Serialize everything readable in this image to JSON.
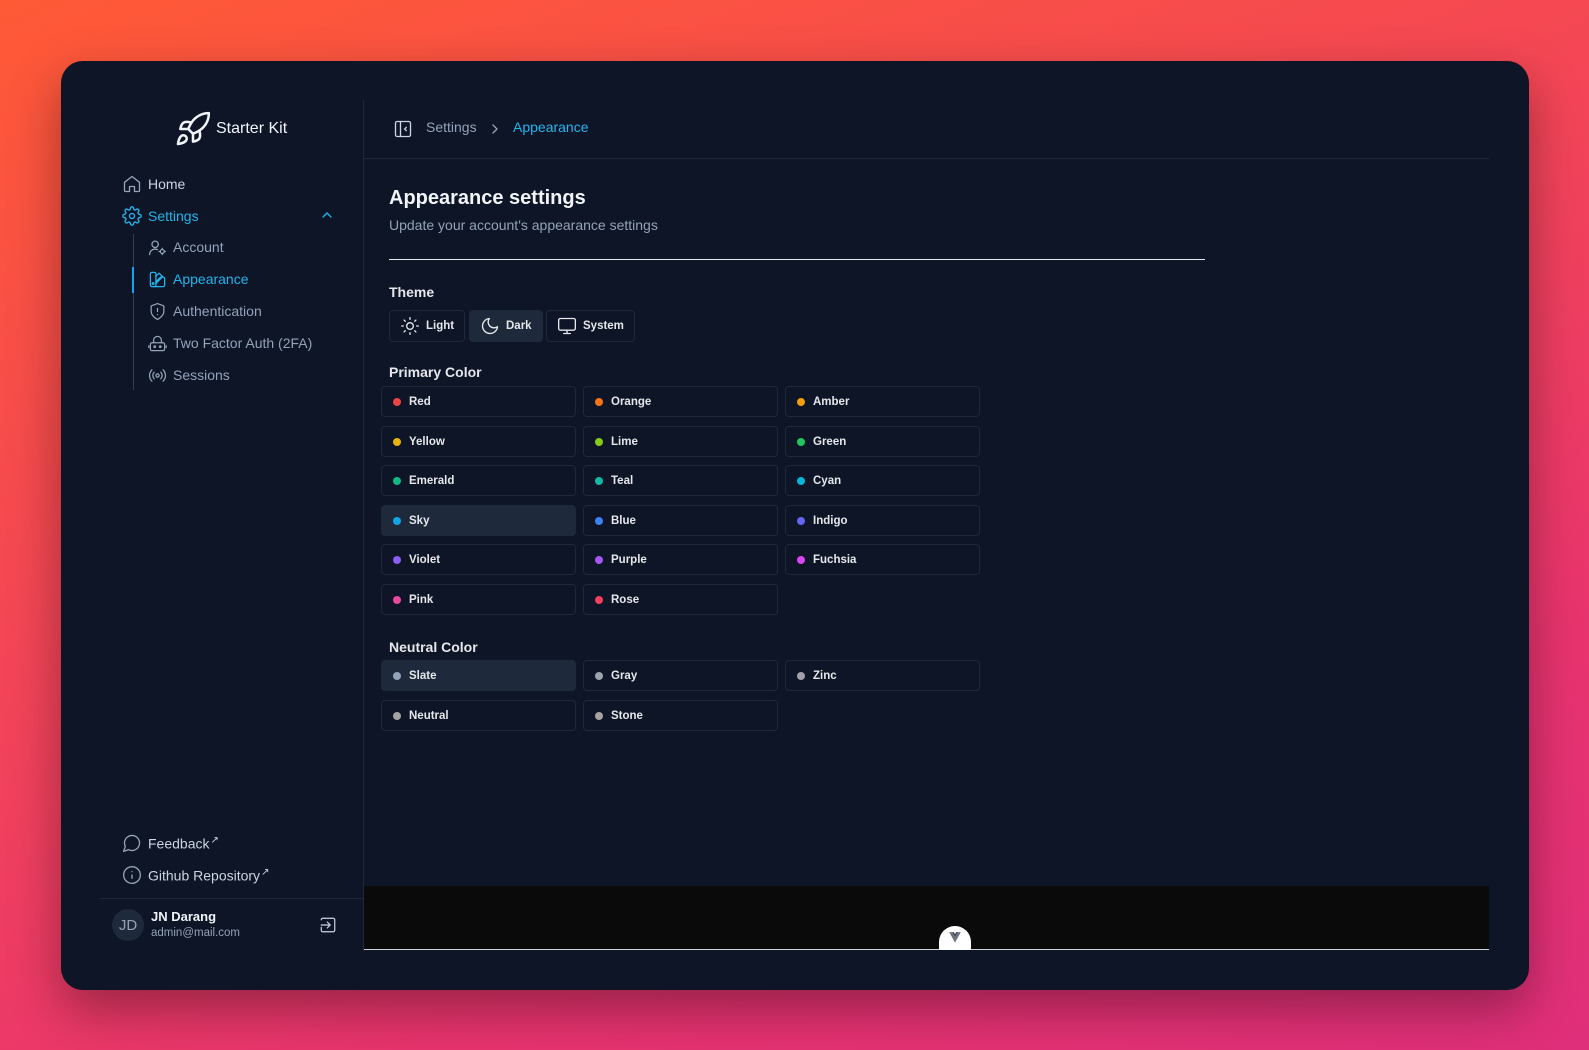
{
  "brand": {
    "name": "Starter Kit",
    "icon": "rocket-icon"
  },
  "sidebar": {
    "nav": [
      {
        "label": "Home",
        "icon": "home-icon"
      },
      {
        "label": "Settings",
        "icon": "gear-icon",
        "expanded": true
      }
    ],
    "sub_items": [
      {
        "label": "Account",
        "icon": "user-cog-icon"
      },
      {
        "label": "Appearance",
        "icon": "palette-icon",
        "active": true
      },
      {
        "label": "Authentication",
        "icon": "shield-icon"
      },
      {
        "label": "Two Factor Auth (2FA)",
        "icon": "bot-icon"
      },
      {
        "label": "Sessions",
        "icon": "radio-icon"
      }
    ],
    "footer_links": [
      {
        "label": "Feedback",
        "icon": "message-icon",
        "external": true
      },
      {
        "label": "Github Repository",
        "icon": "info-icon",
        "external": true
      }
    ],
    "external_glyph": "↗",
    "user": {
      "initials": "JD",
      "name": "JN Darang",
      "email": "admin@mail.com"
    }
  },
  "breadcrumb": {
    "parent": "Settings",
    "current": "Appearance"
  },
  "page": {
    "title": "Appearance settings",
    "subtitle": "Update your account's appearance settings"
  },
  "theme": {
    "label": "Theme",
    "options": [
      {
        "label": "Light",
        "icon": "sun-icon"
      },
      {
        "label": "Dark",
        "icon": "moon-icon",
        "selected": true
      },
      {
        "label": "System",
        "icon": "monitor-icon"
      }
    ]
  },
  "primary_color": {
    "label": "Primary Color",
    "selected": "Sky",
    "options": [
      {
        "label": "Red",
        "color": "#ef4444"
      },
      {
        "label": "Orange",
        "color": "#f97316"
      },
      {
        "label": "Amber",
        "color": "#f59e0b"
      },
      {
        "label": "Yellow",
        "color": "#eab308"
      },
      {
        "label": "Lime",
        "color": "#84cc16"
      },
      {
        "label": "Green",
        "color": "#22c55e"
      },
      {
        "label": "Emerald",
        "color": "#10b981"
      },
      {
        "label": "Teal",
        "color": "#14b8a6"
      },
      {
        "label": "Cyan",
        "color": "#06b6d4"
      },
      {
        "label": "Sky",
        "color": "#0ea5e9"
      },
      {
        "label": "Blue",
        "color": "#3b82f6"
      },
      {
        "label": "Indigo",
        "color": "#6366f1"
      },
      {
        "label": "Violet",
        "color": "#8b5cf6"
      },
      {
        "label": "Purple",
        "color": "#a855f7"
      },
      {
        "label": "Fuchsia",
        "color": "#d946ef"
      },
      {
        "label": "Pink",
        "color": "#ec4899"
      },
      {
        "label": "Rose",
        "color": "#f43f5e"
      }
    ]
  },
  "neutral_color": {
    "label": "Neutral Color",
    "selected": "Slate",
    "options": [
      {
        "label": "Slate",
        "color": "#94a3b8"
      },
      {
        "label": "Gray",
        "color": "#9ca3af"
      },
      {
        "label": "Zinc",
        "color": "#a1a1aa"
      },
      {
        "label": "Neutral",
        "color": "#a3a3a3"
      },
      {
        "label": "Stone",
        "color": "#a8a29e"
      }
    ]
  },
  "colors": {
    "accent": "#22b5ef",
    "background": "#0d1526",
    "border": "#1e293b"
  }
}
